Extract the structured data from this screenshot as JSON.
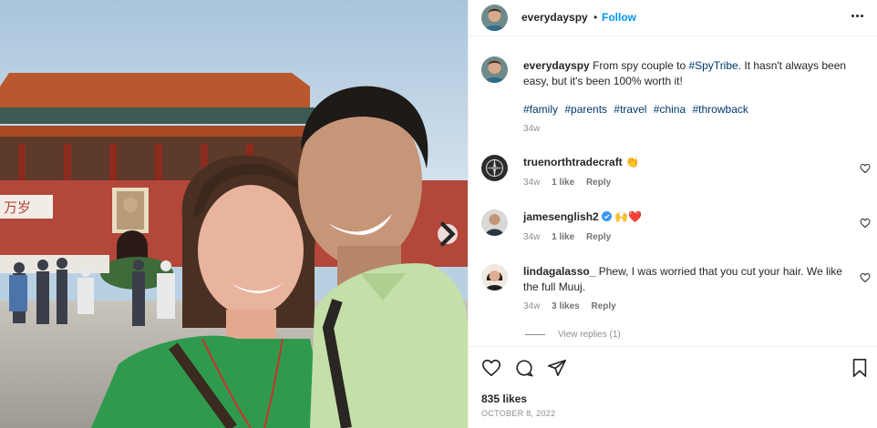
{
  "post": {
    "username": "everydayspy",
    "separator": "•",
    "follow_label": "Follow",
    "more_icon": "more-horizontal-icon",
    "photo_alt": "Selfie of a couple in front of Tiananmen gate",
    "carousel_next_icon": "chevron-right-icon"
  },
  "caption": {
    "username": "everydayspy",
    "text_before": "From spy couple to ",
    "tag": "#SpyTribe",
    "text_after": ". It hasn't always been easy, but it's been 100% worth it!",
    "hashtags": [
      "#family",
      "#parents",
      "#travel",
      "#china",
      "#throwback"
    ],
    "time": "34w"
  },
  "comments": [
    {
      "username": "truenorthtradecraft",
      "text": "👏",
      "time": "34w",
      "likes": "1 like",
      "reply_label": "Reply"
    },
    {
      "username": "jamesenglish2",
      "verified": true,
      "text": "🙌❤️",
      "time": "34w",
      "likes": "1 like",
      "reply_label": "Reply"
    },
    {
      "username": "lindagalasso_",
      "text": "Phew, I was worried that you cut your hair. We like the full Muuj.",
      "time": "34w",
      "likes": "3 likes",
      "reply_label": "Reply"
    }
  ],
  "view_replies_label": "View replies (1)",
  "actions": {
    "like_icon": "heart-icon",
    "comment_icon": "comment-icon",
    "share_icon": "send-icon",
    "save_icon": "bookmark-icon"
  },
  "likes_label": "835 likes",
  "date_label": "OCTOBER 8, 2022",
  "colors": {
    "link_blue": "#0095f6",
    "hashtag": "#00376b",
    "muted": "#8e8e8e",
    "verified": "#3897f0",
    "heart_red": "#e0245e"
  }
}
